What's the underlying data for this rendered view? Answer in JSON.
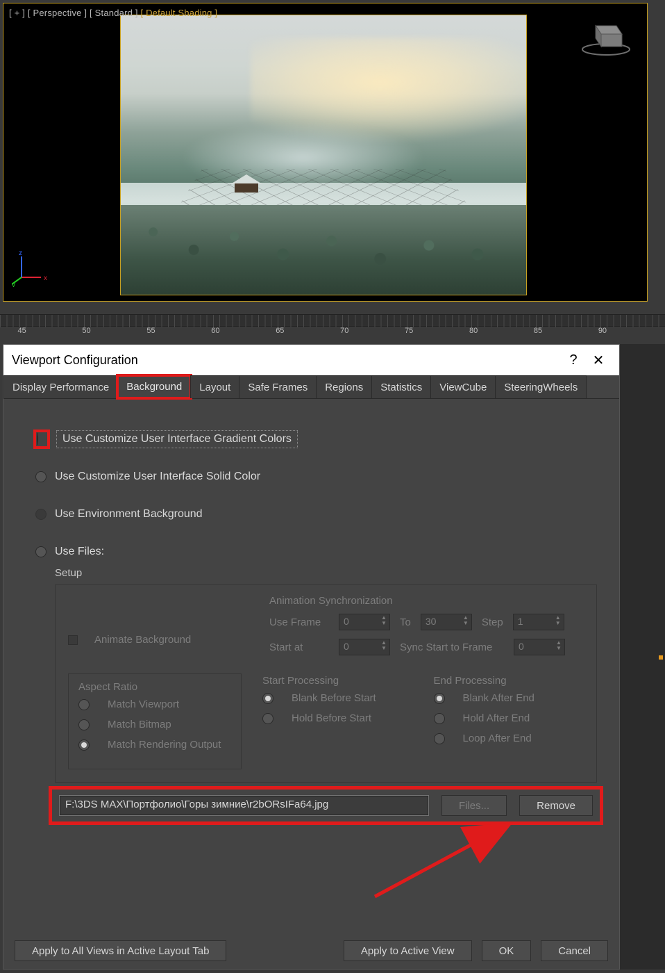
{
  "viewport": {
    "label_plus": "[ + ]",
    "label_persp": "[ Perspective ]",
    "label_std": "[ Standard ]",
    "label_shade": "[ Default Shading ]",
    "axis": {
      "x": "x",
      "y": "y",
      "z": "z"
    }
  },
  "timeline": {
    "ticks": [
      "45",
      "50",
      "55",
      "60",
      "65",
      "70",
      "75",
      "80",
      "85",
      "90"
    ]
  },
  "dialog": {
    "title": "Viewport Configuration",
    "help": "?",
    "close": "✕",
    "tabs": [
      "Display Performance",
      "Background",
      "Layout",
      "Safe Frames",
      "Regions",
      "Statistics",
      "ViewCube",
      "SteeringWheels"
    ],
    "active_tab": 1,
    "radios": {
      "gradient": "Use Customize User Interface Gradient Colors",
      "solid": "Use Customize User Interface Solid Color",
      "env": "Use Environment Background",
      "files": "Use Files:"
    },
    "setup": {
      "label": "Setup",
      "animate_bg": "Animate Background",
      "anim_sync": "Animation Synchronization",
      "use_frame": "Use Frame",
      "to": "To",
      "step": "Step",
      "start_at": "Start at",
      "sync_start": "Sync Start to Frame",
      "vals": {
        "use_frame": "0",
        "to": "30",
        "step": "1",
        "start_at": "0",
        "sync": "0"
      },
      "aspect": {
        "title": "Aspect Ratio",
        "opts": [
          "Match Viewport",
          "Match Bitmap",
          "Match Rendering Output"
        ]
      },
      "start_proc": {
        "title": "Start Processing",
        "opts": [
          "Blank Before Start",
          "Hold Before Start"
        ]
      },
      "end_proc": {
        "title": "End Processing",
        "opts": [
          "Blank After End",
          "Hold After End",
          "Loop After End"
        ]
      }
    },
    "file": {
      "path": "F:\\3DS MAX\\Портфолио\\Горы зимние\\r2bORsIFa64.jpg",
      "files_btn": "Files...",
      "remove_btn": "Remove"
    },
    "buttons": {
      "apply_all": "Apply to All Views in Active Layout Tab",
      "apply_active": "Apply to Active View",
      "ok": "OK",
      "cancel": "Cancel"
    }
  }
}
